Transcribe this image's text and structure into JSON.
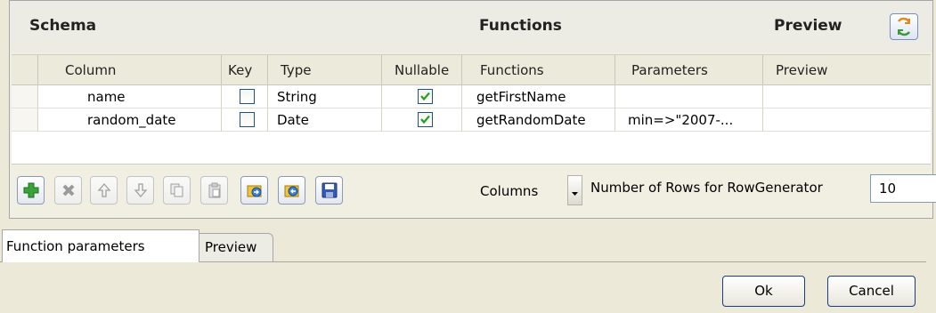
{
  "sections": {
    "schema": "Schema",
    "functions": "Functions",
    "preview": "Preview"
  },
  "icons": {
    "refresh": "refresh-icon"
  },
  "table": {
    "columns": [
      "Column",
      "Key",
      "Type",
      "Nullable",
      "Functions",
      "Parameters",
      "Preview"
    ],
    "rows": [
      {
        "column": "name",
        "key": false,
        "type": "String",
        "nullable": true,
        "function": "getFirstName",
        "parameters": "",
        "preview": ""
      },
      {
        "column": "random_date",
        "key": false,
        "type": "Date",
        "nullable": true,
        "function": "getRandomDate",
        "parameters": "min=>\"2007-...",
        "preview": ""
      }
    ]
  },
  "toolbar": {
    "buttons": [
      "add-icon",
      "remove-icon",
      "move-up-icon",
      "move-down-icon",
      "copy-icon",
      "paste-icon",
      "import-icon",
      "export-icon",
      "save-icon"
    ],
    "columns_label": "Columns",
    "rows_label": "Number of Rows for RowGenerator",
    "rows_value": "10"
  },
  "tabs": {
    "function_parameters": "Function parameters",
    "preview": "Preview"
  },
  "footer": {
    "ok": "Ok",
    "cancel": "Cancel"
  },
  "colors": {
    "check": "#21a121",
    "add": "#3aa33a",
    "accent": "#1a3a82"
  }
}
